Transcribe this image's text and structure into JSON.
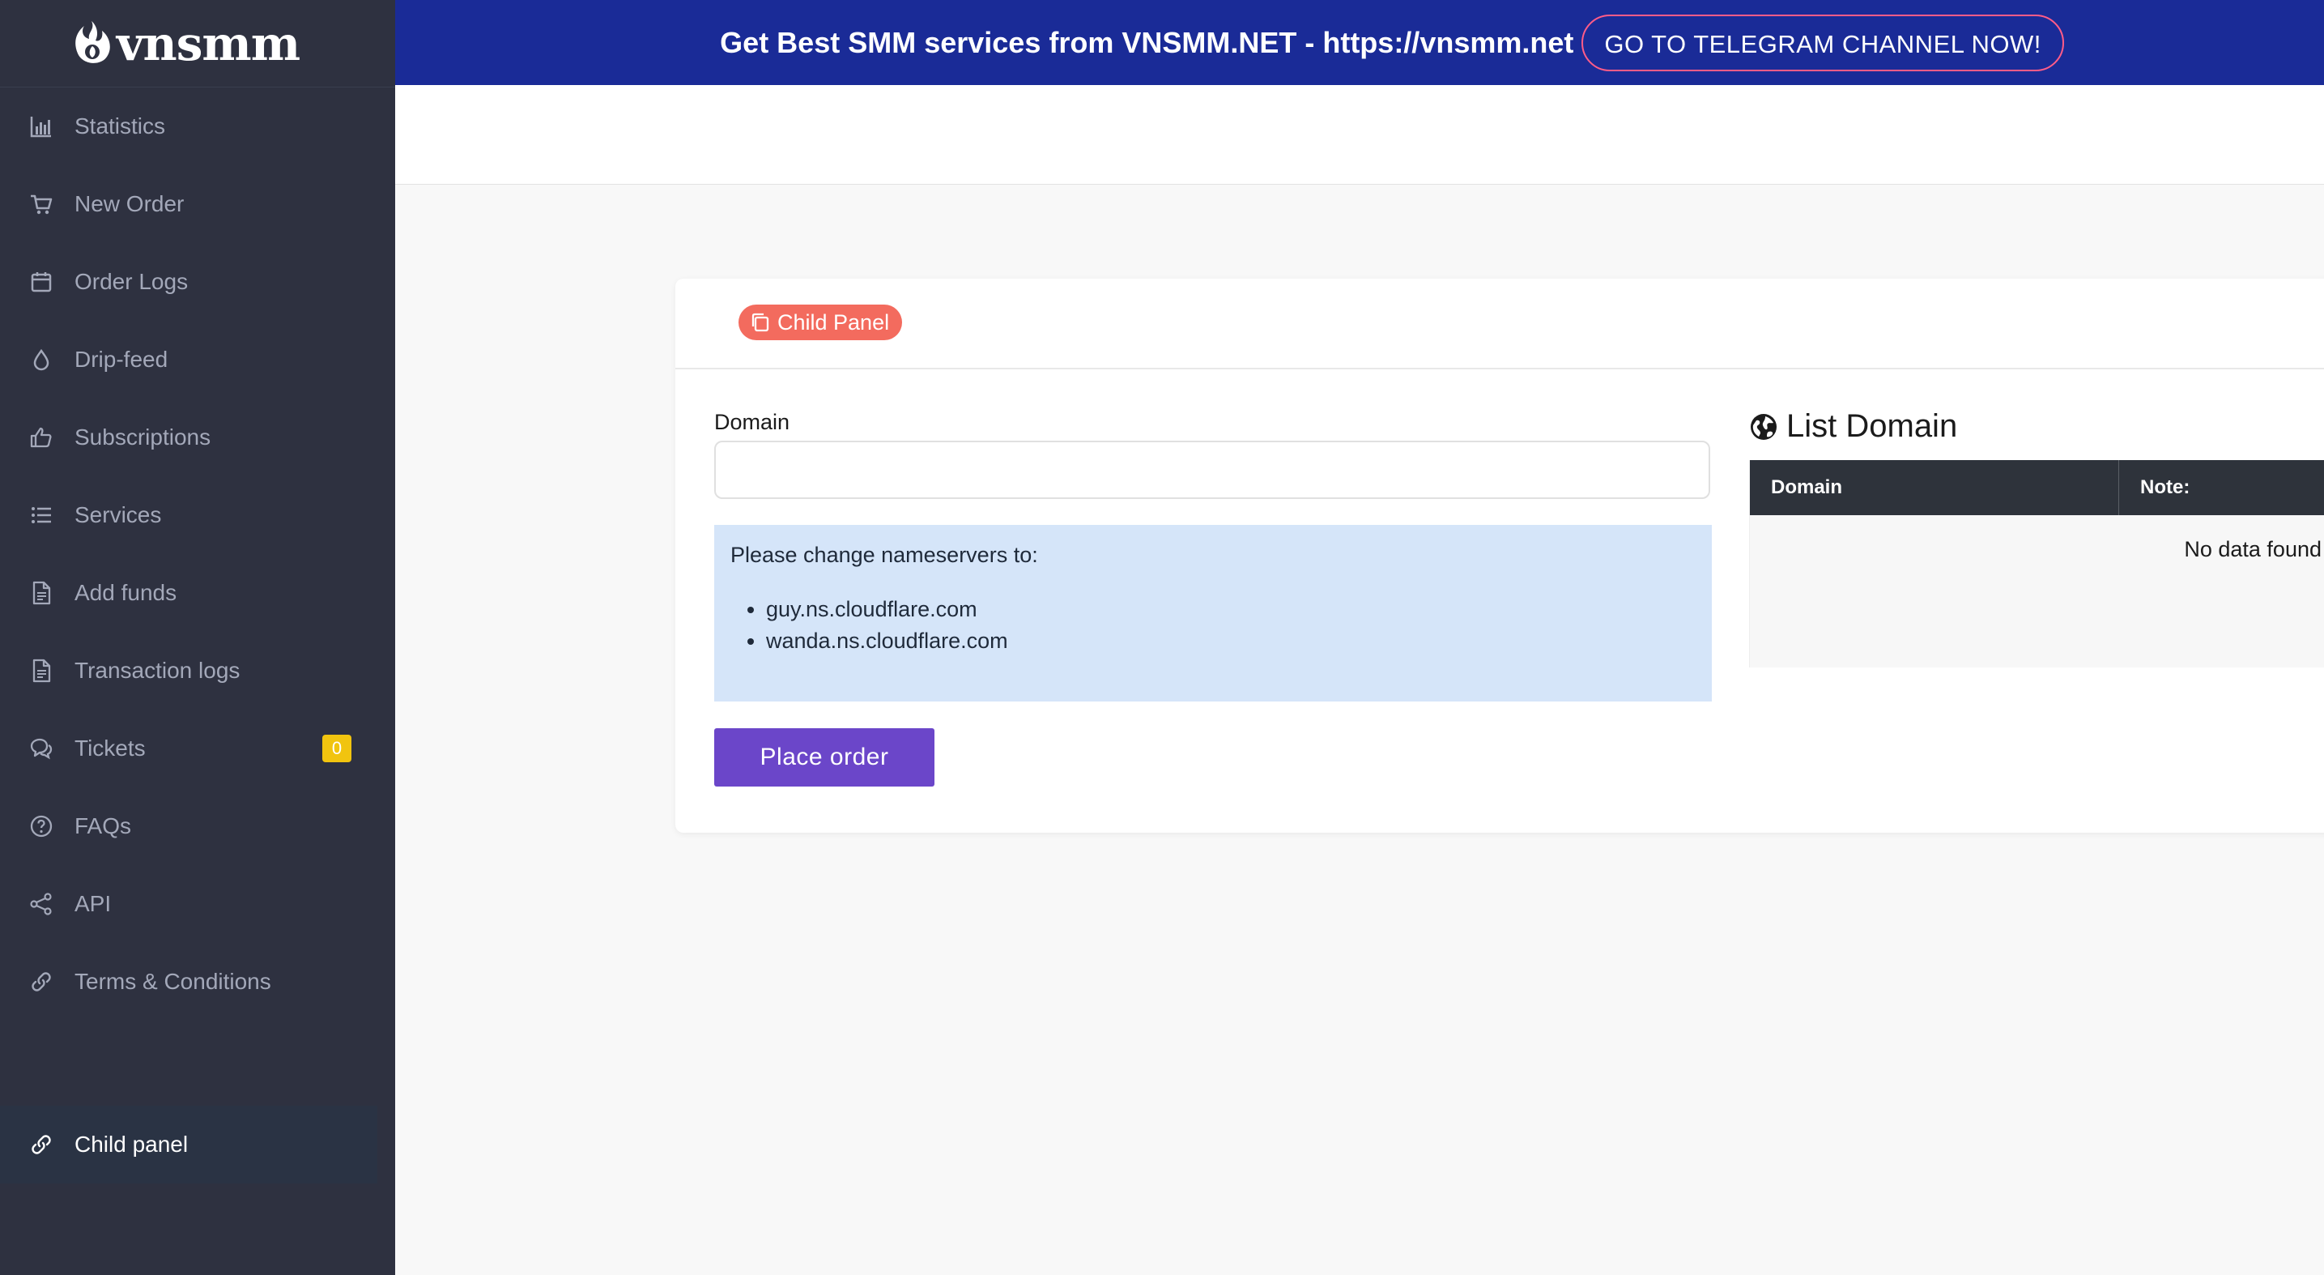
{
  "brand": {
    "name": "vnsmm"
  },
  "sidebar": {
    "items": [
      {
        "label": "Statistics",
        "icon": "bar-chart-icon"
      },
      {
        "label": "New Order",
        "icon": "cart-icon"
      },
      {
        "label": "Order Logs",
        "icon": "calendar-icon"
      },
      {
        "label": "Drip-feed",
        "icon": "droplet-icon"
      },
      {
        "label": "Subscriptions",
        "icon": "thumbs-up-icon"
      },
      {
        "label": "Services",
        "icon": "list-icon"
      },
      {
        "label": "Add funds",
        "icon": "document-icon"
      },
      {
        "label": "Transaction logs",
        "icon": "document-icon"
      },
      {
        "label": "Tickets",
        "icon": "chat-icon",
        "badge": "0"
      },
      {
        "label": "FAQs",
        "icon": "question-circle-icon"
      },
      {
        "label": "API",
        "icon": "share-icon"
      },
      {
        "label": "Terms & Conditions",
        "icon": "link-icon"
      },
      {
        "label": "Child panel",
        "icon": "link-icon",
        "active": true
      }
    ]
  },
  "banner": {
    "text": "Get Best SMM services from VNSMM.NET - https://vnsmm.net",
    "button_label": "GO TO TELEGRAM CHANNEL NOW!"
  },
  "card": {
    "tab_label": "Child Panel",
    "domain_label": "Domain",
    "domain_value": "",
    "info": {
      "intro": "Please change nameservers to:",
      "nameservers": [
        "guy.ns.cloudflare.com",
        "wanda.ns.cloudflare.com"
      ]
    },
    "place_order_label": "Place order",
    "list": {
      "title": "List Domain",
      "columns": [
        "Domain",
        "Note:"
      ],
      "empty_text": "No data found"
    }
  },
  "colors": {
    "sidebar_bg": "#2e3140",
    "banner_bg": "#1a2b97",
    "banner_button_border": "#ff5c88",
    "pill_bg": "#f36b5e",
    "info_bg": "#d5e5f9",
    "primary_button": "#6b46c9",
    "table_header_bg": "#2e333b",
    "badge_bg": "#f1c40f"
  }
}
